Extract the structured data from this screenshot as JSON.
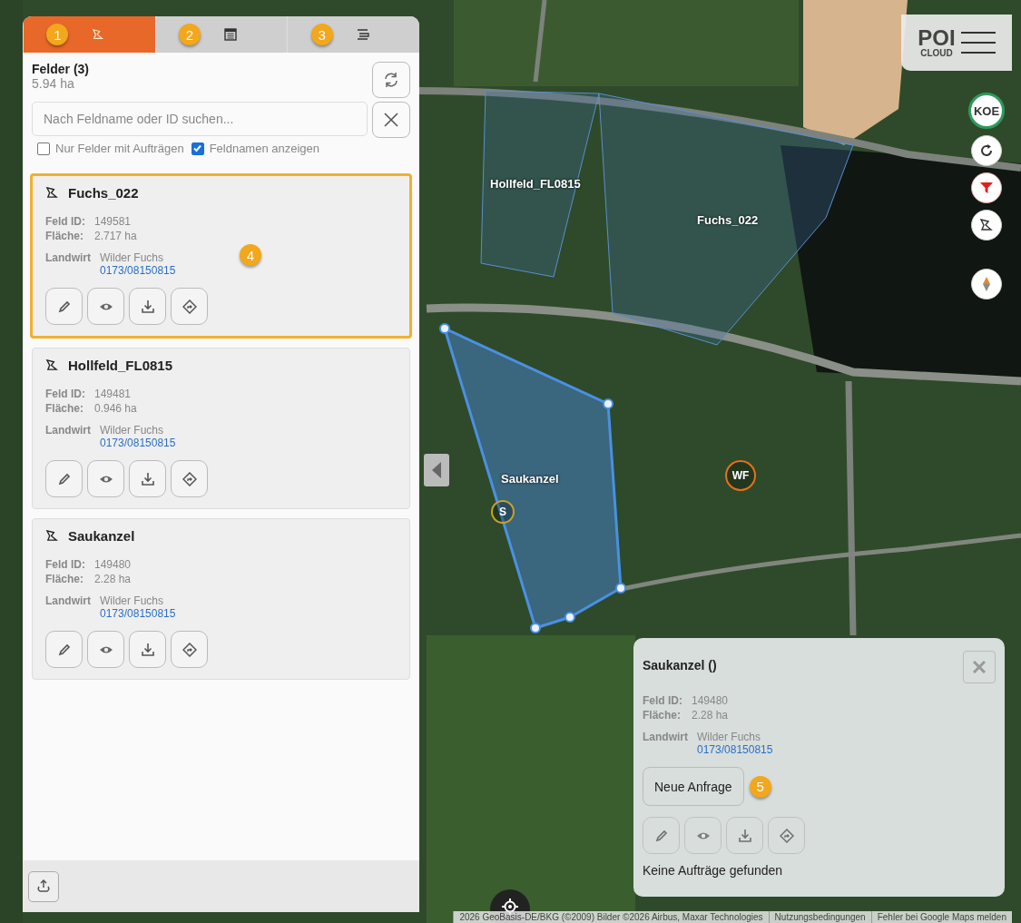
{
  "panel": {
    "tabs": [
      {
        "kind": "fields",
        "badge": "1",
        "selected": true
      },
      {
        "kind": "calendar",
        "badge": "2",
        "selected": false
      },
      {
        "kind": "list",
        "badge": "3",
        "selected": false
      }
    ],
    "title": "Felder (3)",
    "total_area": "5.94 ha",
    "search": {
      "placeholder": "Nach Feldname oder ID suchen..."
    },
    "filters": [
      {
        "label": "Nur Felder mit Aufträgen",
        "checked": false
      },
      {
        "label": "Feldnamen anzeigen",
        "checked": true
      }
    ],
    "fields": [
      {
        "name": "Fuchs_022",
        "id_label": "Feld ID:",
        "id": "149581",
        "area_label": "Fläche:",
        "area": "2.717 ha",
        "farmer_label": "Landwirt",
        "farmer": "Wilder Fuchs",
        "phone": "0173/08150815",
        "selected": true,
        "badge": "4"
      },
      {
        "name": "Hollfeld_FL0815",
        "id_label": "Feld ID:",
        "id": "149481",
        "area_label": "Fläche:",
        "area": "0.946 ha",
        "farmer_label": "Landwirt",
        "farmer": "Wilder Fuchs",
        "phone": "0173/08150815",
        "selected": false
      },
      {
        "name": "Saukanzel",
        "id_label": "Feld ID:",
        "id": "149480",
        "area_label": "Fläche:",
        "area": "2.28 ha",
        "farmer_label": "Landwirt",
        "farmer": "Wilder Fuchs",
        "phone": "0173/08150815",
        "selected": false
      }
    ]
  },
  "map": {
    "labels": [
      "Hollfeld_FL0815",
      "Fuchs_022",
      "Saukanzel"
    ],
    "markers": [
      {
        "text": "S",
        "color": "#c9a227"
      },
      {
        "text": "WF",
        "color": "#e8701a"
      }
    ],
    "logo": {
      "top": "POI",
      "bottom": "CLOUD"
    },
    "user_button": "KOE",
    "attribution": [
      "2026 GeoBasis-DE/BKG (©2009) Bilder ©2026 Airbus, Maxar Technologies",
      "Nutzungsbedingungen",
      "Fehler bei Google Maps melden"
    ]
  },
  "popup": {
    "title": "Saukanzel ()",
    "id_label": "Feld ID:",
    "id": "149480",
    "area_label": "Fläche:",
    "area": "2.28 ha",
    "farmer_label": "Landwirt",
    "farmer": "Wilder Fuchs",
    "phone": "0173/08150815",
    "button": "Neue Anfrage",
    "badge": "5",
    "empty": "Keine Aufträge gefunden"
  }
}
